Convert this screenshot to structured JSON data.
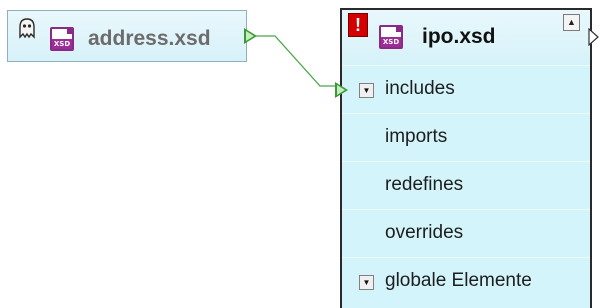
{
  "nodes": {
    "address": {
      "title": "address.xsd",
      "icon": "ghost-icon",
      "file_icon": "xsd-file-icon",
      "file_icon_text": "XSD"
    },
    "ipo": {
      "title": "ipo.xsd",
      "warning_icon": "error-icon",
      "warning_text": "!",
      "file_icon": "xsd-file-icon",
      "file_icon_text": "XSD",
      "collapse_glyph": "▲",
      "rows": [
        {
          "label": "includes",
          "expandable": true,
          "glyph": "▼"
        },
        {
          "label": "imports",
          "expandable": false
        },
        {
          "label": "redefines",
          "expandable": false
        },
        {
          "label": "overrides",
          "expandable": false
        },
        {
          "label": "globale Elemente",
          "expandable": true,
          "glyph": "▼"
        }
      ]
    }
  },
  "colors": {
    "node_bg": "#d2f4fa",
    "connector": "#4aa64a",
    "file_icon": "#9b2f97",
    "warning": "#d40000"
  }
}
